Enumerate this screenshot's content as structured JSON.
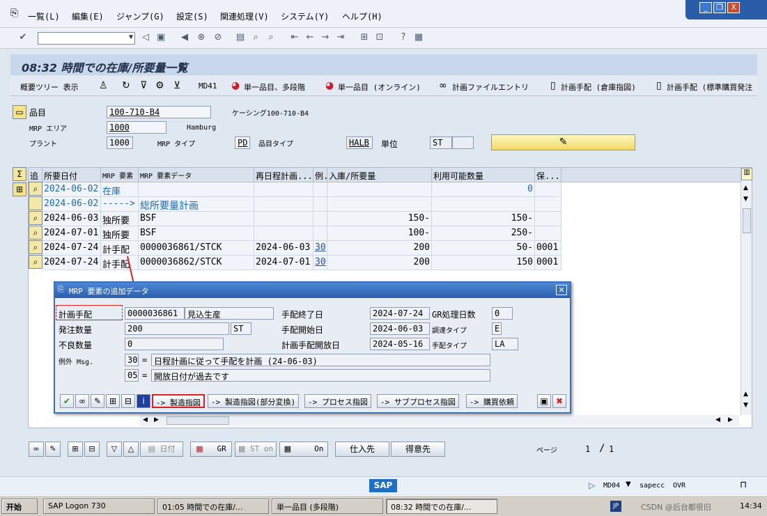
{
  "menu": [
    "一覧(L)",
    "編集(E)",
    "ジャンプ(G)",
    "設定(S)",
    "関連処理(V)",
    "システム(Y)",
    "ヘルプ(H)"
  ],
  "window_controls": {
    "minimize": "_",
    "restore": "❐",
    "close": "X"
  },
  "page_title": "08:32 時間での在庫/所要量一覧",
  "app_toolbar": {
    "tree": "概要ツリー 表示",
    "md41": "MD41",
    "single_multi": "単一品目、多段階",
    "single_online": "単一品目 (オンライン)",
    "plan_file": "計画ファイルエントリ",
    "plan_order_wh": "計画手配 (倉庫指図)",
    "plan_order_std": "計画手配 (標準購買発注"
  },
  "header": {
    "material_label": "品目",
    "material_value": "100-710-B4",
    "casing_text": "ケーシング100-710-B4",
    "mrp_area_label": "MRP エリア",
    "mrp_area_value": "1000",
    "mrp_area_name": "Hamburg",
    "plant_label": "プラント",
    "plant_value": "1000",
    "mrp_type_label": "MRP タイプ",
    "mrp_type_value": "PD",
    "material_type_label": "品目タイプ",
    "material_type_value": "HALB",
    "unit_label": "単位",
    "unit_value": "ST"
  },
  "grid": {
    "columns": [
      "追",
      "所要日付",
      "MRP 要素",
      "MRP 要素データ",
      "再日程計画...",
      "例.",
      "入庫/所要量",
      "利用可能数量",
      "保..."
    ],
    "rows": [
      {
        "date": "2024-06-02",
        "element": "在庫",
        "data": "",
        "resched": "",
        "exc": "",
        "qty": "",
        "avail": "0",
        "stor": ""
      },
      {
        "date": "2024-06-02",
        "element": "----->",
        "data": "総所要量計画",
        "resched": "",
        "exc": "",
        "qty": "",
        "avail": "",
        "stor": ""
      },
      {
        "date": "2024-06-03",
        "element": "独所要",
        "data": "BSF",
        "resched": "",
        "exc": "",
        "qty": "150-",
        "avail": "150-",
        "stor": ""
      },
      {
        "date": "2024-07-01",
        "element": "独所要",
        "data": "BSF",
        "resched": "",
        "exc": "",
        "qty": "100-",
        "avail": "250-",
        "stor": ""
      },
      {
        "date": "2024-07-24",
        "element": "計手配",
        "data": "0000036861/STCK",
        "resched": "2024-06-03",
        "exc": "30",
        "qty": "200",
        "avail": "50-",
        "stor": "0001"
      },
      {
        "date": "2024-07-24",
        "element": "計手配",
        "data": "0000036862/STCK",
        "resched": "2024-07-01",
        "exc": "30",
        "qty": "200",
        "avail": "150",
        "stor": "0001"
      }
    ]
  },
  "popup": {
    "title": "MRP 要素の追加データ",
    "planned_order_label": "計画手配",
    "planned_order_value": "0000036861",
    "planned_order_text": "見込生産",
    "order_qty_label": "発注数量",
    "order_qty_value": "200",
    "order_unit": "ST",
    "scrap_label": "不良数量",
    "scrap_value": "0",
    "exception_label": "例外 Msg.",
    "exc1_code": "30",
    "exc1_eq": "=",
    "exc1_text": "日程計画に従って手配を計画 (24-06-03)",
    "exc2_code": "05",
    "exc2_eq": "=",
    "exc2_text": "開放日付が過去です",
    "finish_label": "手配終了日",
    "finish_value": "2024-07-24",
    "start_label": "手配開始日",
    "start_value": "2024-06-03",
    "open_label": "計画手配開放日",
    "open_value": "2024-05-16",
    "gr_days_label": "GR処理日数",
    "gr_days_value": "0",
    "proc_type_label": "調達タイプ",
    "proc_type_value": "E",
    "order_type_label": "手配タイプ",
    "order_type_value": "LA",
    "buttons": {
      "prod_order": "-> 製造指図",
      "prod_order_partial": "-> 製造指図(部分変換)",
      "process_order": "-> プロセス指図",
      "subprocess_order": "-> サブプロセス指図",
      "purchase_req": "-> 購買依頼"
    }
  },
  "bottom_buttons": {
    "date": "日付",
    "gr": "GR",
    "st_on": "ST on",
    "on": "On",
    "vendor": "仕入先",
    "customer": "得意先",
    "page_label": "ページ",
    "page_current": "1",
    "page_sep": "/",
    "page_total": "1"
  },
  "status": {
    "sap_logo": "SAP",
    "tcode": "MD04",
    "server": "sapecc",
    "mode": "OVR"
  },
  "taskbar": {
    "start": "开始",
    "tasks": [
      "SAP Logon 730",
      "01:05 時間での在庫/...",
      "単一品目 (多段階)",
      "08:32 時間での在庫/..."
    ],
    "tray_ime": "JP",
    "clock": "14:34",
    "watermark": "CSDN @后台都很旧"
  },
  "colors": {
    "annotation_red": "#e02020",
    "link_blue": "#1b4bb3",
    "title_bar": "#c8d7eb"
  }
}
